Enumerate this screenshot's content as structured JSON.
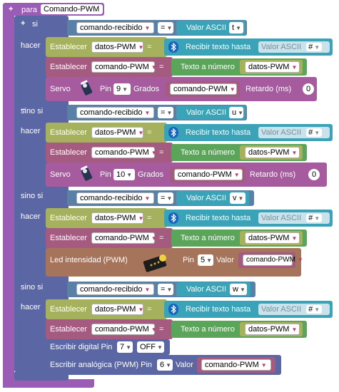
{
  "procedure": {
    "keyword": "para",
    "name": "Comando-PWM"
  },
  "if_block": {
    "si": "si",
    "sino_si": "sino si",
    "hacer": "hacer"
  },
  "conditions": [
    {
      "variable": "comando-recibido",
      "operator": "=",
      "text": "Valor ASCII",
      "char": "t"
    },
    {
      "variable": "comando-recibido",
      "operator": "=",
      "text": "Valor ASCII",
      "char": "u"
    },
    {
      "variable": "comando-recibido",
      "operator": "=",
      "text": "Valor ASCII",
      "char": "v"
    },
    {
      "variable": "comando-recibido",
      "operator": "=",
      "text": "Valor ASCII",
      "char": "w"
    }
  ],
  "set_bt": {
    "label": "Establecer",
    "variable": "datos-PWM",
    "eq": "=",
    "text": "Recibir texto hasta",
    "ascii_label": "Valor ASCII",
    "char": "#"
  },
  "set_num": {
    "label": "Establecer",
    "variable": "comando-PWM",
    "eq": "=",
    "text": "Texto a número",
    "source": "datos-PWM"
  },
  "servo1": {
    "label": "Servo",
    "pin_label": "Pin",
    "pin": "9",
    "grados": "Grados",
    "value": "comando-PWM",
    "retardo": "Retardo (ms)",
    "delay": "0"
  },
  "servo2": {
    "label": "Servo",
    "pin_label": "Pin",
    "pin": "10",
    "grados": "Grados",
    "value": "comando-PWM",
    "retardo": "Retardo (ms)",
    "delay": "0"
  },
  "led": {
    "label": "Led intensidad (PWM)",
    "pin_label": "Pin",
    "pin": "5",
    "valor": "Valor",
    "value": "comando-PWM"
  },
  "digital": {
    "label": "Escribir digital Pin",
    "pin": "7",
    "state": "OFF"
  },
  "analog": {
    "label": "Escribir analógica (PWM) Pin",
    "pin": "6",
    "valor": "Valor",
    "value": "comando-PWM"
  },
  "colors": {
    "procedure": "#9a5cb4",
    "control": "#5b67a5",
    "logic": "#5b80a5",
    "variables": "#a5b15c",
    "bluetooth": "#3aa3b7",
    "setvar": "#a55b80",
    "servo": "#a55b9e",
    "led": "#a5745b"
  }
}
